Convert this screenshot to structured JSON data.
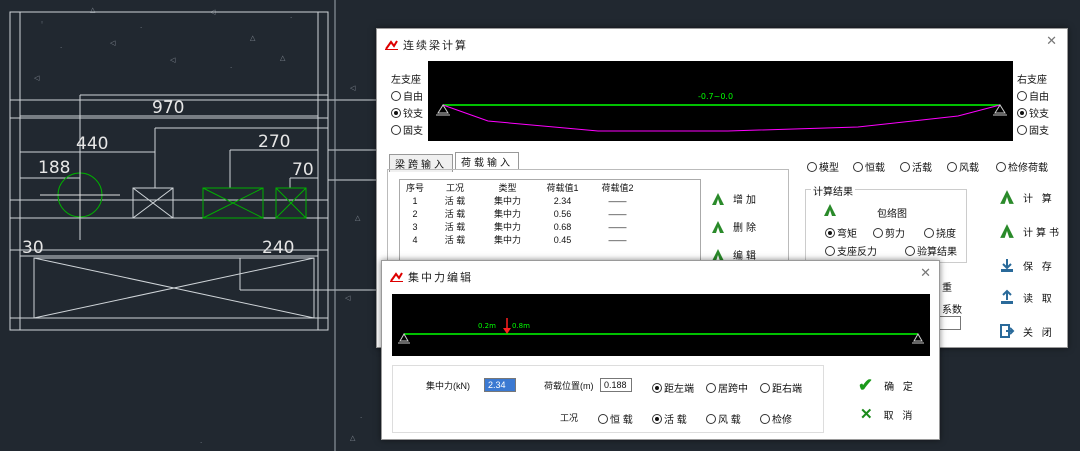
{
  "cad": {
    "dims": [
      "970",
      "440",
      "270",
      "188",
      "70",
      "30",
      "240"
    ]
  },
  "main_dialog": {
    "title": "连续梁计算",
    "left_support": {
      "label": "左支座",
      "options": [
        "自由",
        "铰支",
        "固支"
      ],
      "selected": 1
    },
    "right_support": {
      "label": "右支座",
      "options": [
        "自由",
        "铰支",
        "固支"
      ],
      "selected": 1
    },
    "beam_label": "-0.7~0.0",
    "tabs": [
      "梁跨输入",
      "荷载输入"
    ],
    "active_tab": 1,
    "load_cases": [
      "模型",
      "恒载",
      "活载",
      "风载",
      "检修荷载"
    ],
    "table": {
      "headers": [
        "序号",
        "工况",
        "类型",
        "荷载值1",
        "荷载值2"
      ],
      "rows": [
        [
          "1",
          "活 载",
          "集中力",
          "2.34",
          "——"
        ],
        [
          "2",
          "活 载",
          "集中力",
          "0.56",
          "——"
        ],
        [
          "3",
          "活 载",
          "集中力",
          "0.68",
          "——"
        ],
        [
          "4",
          "活 载",
          "集中力",
          "0.45",
          "——"
        ]
      ]
    },
    "table_buttons": [
      "增加",
      "删除",
      "编辑"
    ],
    "results": {
      "label": "计算结果",
      "diagram_label": "包络图",
      "options": [
        "弯矩",
        "剪力",
        "挠度",
        "支座反力",
        "验算结果"
      ],
      "selected": 0
    },
    "partial": {
      "text1": "重",
      "text2": "系数"
    },
    "right_buttons": [
      "计 算",
      "计算书",
      "保 存",
      "读 取",
      "关 闭"
    ]
  },
  "sub_dialog": {
    "title": "集中力编辑",
    "beam_label": "0.2m",
    "beam_label2": "0.8m",
    "force_label": "集中力(kN)",
    "force_value": "2.34",
    "pos_label": "荷载位置(m)",
    "pos_value": "0.188",
    "pos_options": [
      "距左端",
      "居跨中",
      "距右端"
    ],
    "pos_selected": 0,
    "case_label": "工况",
    "case_options": [
      "恒 载",
      "活 载",
      "风 载",
      "检修"
    ],
    "case_selected": 1,
    "ok_label": "确 定",
    "cancel_label": "取 消"
  },
  "colors": {
    "beam": "#00ff00",
    "moment": "#ff00ff",
    "force": "#ff2020"
  }
}
